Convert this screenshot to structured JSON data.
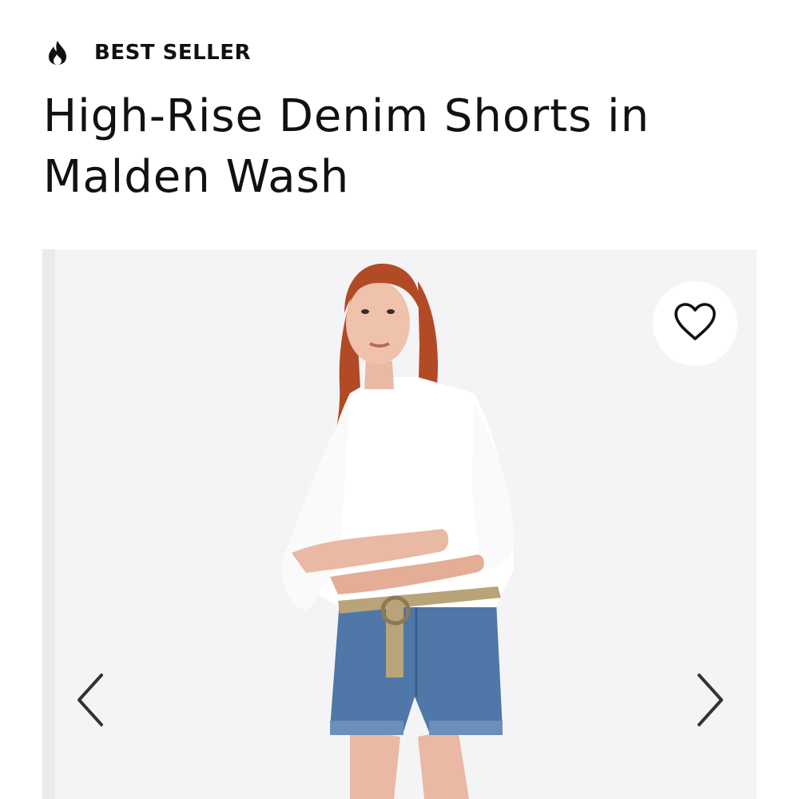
{
  "badge": {
    "icon": "flame-icon",
    "label": "BEST SELLER"
  },
  "product": {
    "title": "High-Rise Denim Shorts in Malden Wash"
  },
  "gallery": {
    "favorite_icon": "heart-outline-icon",
    "prev_icon": "chevron-left-icon",
    "next_icon": "chevron-right-icon"
  },
  "colors": {
    "text": "#111111",
    "image_background": "#f4f4f6",
    "shirt": "#ffffff",
    "denim": "#4f77a8",
    "hair": "#b24a26",
    "belt": "#b9a47a"
  }
}
